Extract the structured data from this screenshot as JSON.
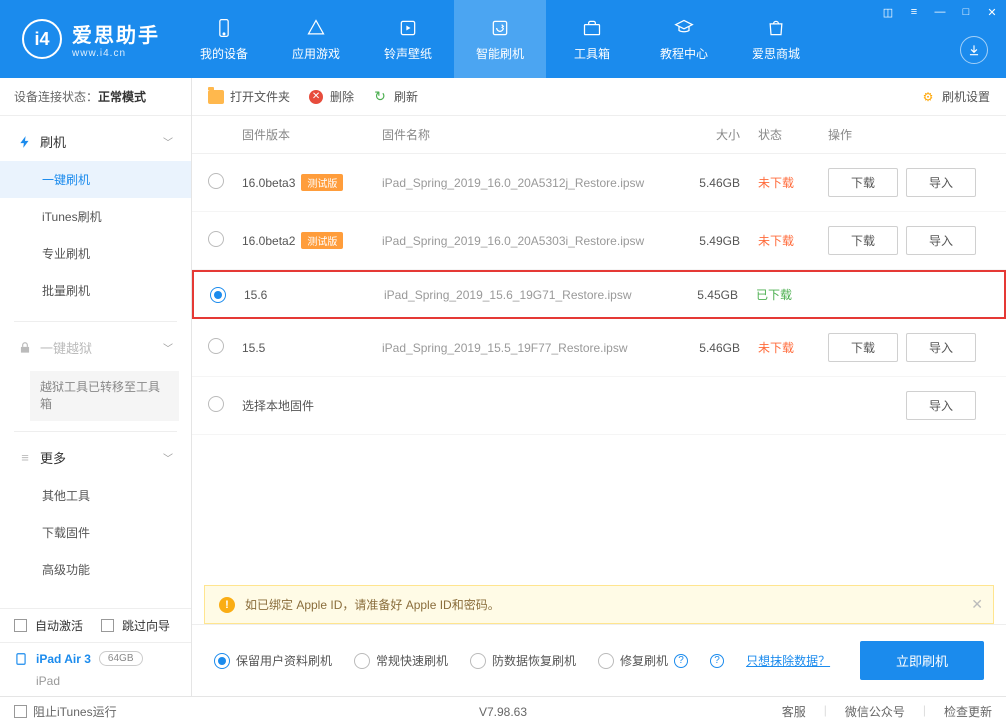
{
  "header": {
    "app_name": "爱思助手",
    "app_url": "www.i4.cn",
    "nav": [
      {
        "label": "我的设备"
      },
      {
        "label": "应用游戏"
      },
      {
        "label": "铃声壁纸"
      },
      {
        "label": "智能刷机"
      },
      {
        "label": "工具箱"
      },
      {
        "label": "教程中心"
      },
      {
        "label": "爱思商城"
      }
    ]
  },
  "sidebar": {
    "conn_label": "设备连接状态：",
    "conn_value": "正常模式",
    "group_flash": "刷机",
    "items_flash": [
      "一键刷机",
      "iTunes刷机",
      "专业刷机",
      "批量刷机"
    ],
    "group_jailbreak": "一键越狱",
    "jb_note": "越狱工具已转移至工具箱",
    "group_more": "更多",
    "items_more": [
      "其他工具",
      "下载固件",
      "高级功能"
    ],
    "auto_activate": "自动激活",
    "skip_guide": "跳过向导",
    "device_name": "iPad Air 3",
    "device_storage": "64GB",
    "device_type": "iPad"
  },
  "toolbar": {
    "open_folder": "打开文件夹",
    "delete": "删除",
    "refresh": "刷新",
    "settings": "刷机设置"
  },
  "table": {
    "headers": {
      "version": "固件版本",
      "name": "固件名称",
      "size": "大小",
      "status": "状态",
      "op": "操作"
    },
    "rows": [
      {
        "version": "16.0beta3",
        "beta": "测试版",
        "name": "iPad_Spring_2019_16.0_20A5312j_Restore.ipsw",
        "size": "5.46GB",
        "status": "未下载",
        "downloaded": false,
        "selected": false
      },
      {
        "version": "16.0beta2",
        "beta": "测试版",
        "name": "iPad_Spring_2019_16.0_20A5303i_Restore.ipsw",
        "size": "5.49GB",
        "status": "未下载",
        "downloaded": false,
        "selected": false
      },
      {
        "version": "15.6",
        "beta": "",
        "name": "iPad_Spring_2019_15.6_19G71_Restore.ipsw",
        "size": "5.45GB",
        "status": "已下载",
        "downloaded": true,
        "selected": true
      },
      {
        "version": "15.5",
        "beta": "",
        "name": "iPad_Spring_2019_15.5_19F77_Restore.ipsw",
        "size": "5.46GB",
        "status": "未下载",
        "downloaded": false,
        "selected": false
      }
    ],
    "local_row": "选择本地固件",
    "btn_download": "下载",
    "btn_import": "导入"
  },
  "warning_text": "如已绑定 Apple ID，请准备好 Apple ID和密码。",
  "options": {
    "opt1": "保留用户资料刷机",
    "opt2": "常规快速刷机",
    "opt3": "防数据恢复刷机",
    "opt4": "修复刷机",
    "erase_link": "只想抹除数据？",
    "flash_btn": "立即刷机"
  },
  "footer": {
    "stop_itunes": "阻止iTunes运行",
    "version": "V7.98.63",
    "links": [
      "客服",
      "微信公众号",
      "检查更新"
    ]
  }
}
